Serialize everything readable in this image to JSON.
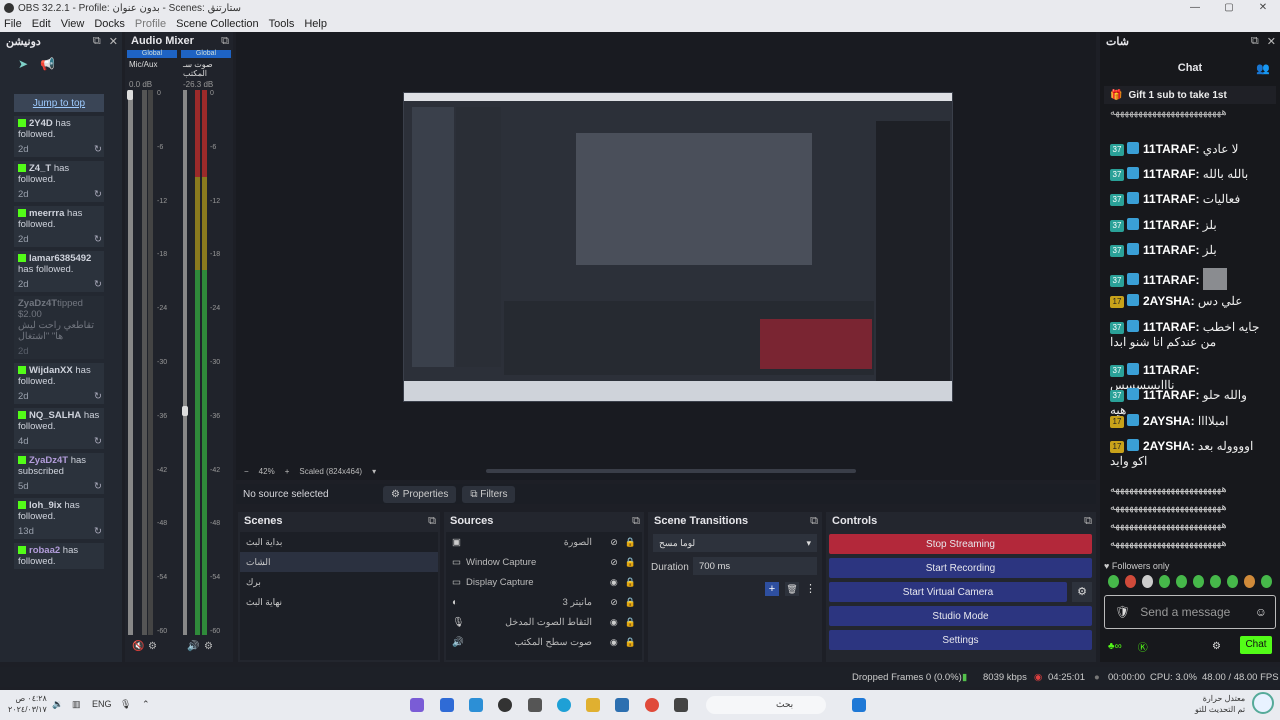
{
  "window": {
    "title": "OBS 32.2.1 - Profile: بدون عنوان - Scenes: ستارتنق",
    "min": "—",
    "max": "▢",
    "close": "✕"
  },
  "menu": [
    "File",
    "Edit",
    "View",
    "Docks",
    "Profile",
    "Scene Collection",
    "Tools",
    "Help"
  ],
  "activity": {
    "title": "دونيشن",
    "jump": "Jump to top",
    "items": [
      {
        "name": "2Y4D",
        "text": "has followed.",
        "age": "2d"
      },
      {
        "name": "Z4_T",
        "text": "has followed.",
        "age": "2d"
      },
      {
        "name": "meerrra",
        "text": "has followed.",
        "age": "2d"
      },
      {
        "name": "lamar6385492",
        "text": "has followed.",
        "age": "2d"
      },
      {
        "name": "ZyaDz4T",
        "text": "tipped $2.00",
        "extra": "تقاطعي راحت ليش ها\" \"اشتغال",
        "age": "2d"
      },
      {
        "name": "WijdanXX",
        "text": "has followed.",
        "age": "2d"
      },
      {
        "name": "NQ_SALHA",
        "text": "has followed.",
        "age": "4d"
      },
      {
        "name": "ZyaDz4T",
        "text": "has subscribed",
        "age": "5d"
      },
      {
        "name": "loh_9ix",
        "text": "has followed.",
        "age": "13d"
      },
      {
        "name": "robaa2",
        "text": "has followed.",
        "age": ""
      }
    ]
  },
  "mixer": {
    "title": "Audio Mixer",
    "chan1": {
      "tag": "Global",
      "name": "Mic/Aux",
      "db": "0.0 dB"
    },
    "chan2": {
      "tag": "Global",
      "name": "صوت سـ المكتب",
      "db": "-26.3 dB"
    },
    "ticks": [
      "0",
      "-6",
      "-12",
      "-18",
      "-24",
      "-30",
      "-36",
      "-42",
      "-48",
      "-54",
      "-60"
    ],
    "levels": {
      "chan1_fader": 0.0,
      "chan2_fader": 0.58
    }
  },
  "preview": {
    "zoom": "42%",
    "scaled": "Scaled (824x464)",
    "minus": "−",
    "plus": "+"
  },
  "sourcebar": {
    "no_source": "No source selected",
    "properties": "Properties",
    "filters": "Filters"
  },
  "scenes": {
    "title": "Scenes",
    "items": [
      "بداية البث",
      "الشات",
      "برك",
      "نهاية البث"
    ],
    "selected": 1
  },
  "sources": {
    "title": "Sources",
    "items": [
      "الصورة",
      "Window Capture",
      "Display Capture",
      "مانيتر 3",
      "التقاط الصوت المدخل",
      "صوت سطح المكتب"
    ]
  },
  "transitions": {
    "title": "Scene Transitions",
    "type": "لوما مسح",
    "duration_label": "Duration",
    "duration": "700 ms"
  },
  "controls": {
    "title": "Controls",
    "stop_stream": "Stop Streaming",
    "start_rec": "Start Recording",
    "start_vcam": "Start Virtual Camera",
    "studio": "Studio Mode",
    "settings": "Settings"
  },
  "chat": {
    "dock_title": "شات",
    "title": "Chat",
    "pinned": "Gift 1 sub to take 1st",
    "messages": [
      {
        "badge": "37",
        "user": "11TARAF:",
        "text": "لا عادي"
      },
      {
        "badge": "37",
        "user": "11TARAF:",
        "text": "بالله بالله"
      },
      {
        "badge": "37",
        "user": "11TARAF:",
        "text": "فعاليات"
      },
      {
        "badge": "37",
        "user": "11TARAF:",
        "text": "بلز"
      },
      {
        "badge": "37",
        "user": "11TARAF:",
        "text": "بلز"
      },
      {
        "badge": "37",
        "user": "11TARAF:",
        "text": ""
      },
      {
        "badge": "17",
        "user": "2AYSHA:",
        "text": "علي دس"
      },
      {
        "badge": "37",
        "user": "11TARAF:",
        "text": "جايه اخطب من عندكم انا شنو ابدا"
      },
      {
        "badge": "37",
        "user": "11TARAF:",
        "text": "نااايسسسس"
      },
      {
        "badge": "37",
        "user": "11TARAF:",
        "text": "والله حلو هيه"
      },
      {
        "badge": "17",
        "user": "2AYSHA:",
        "text": "امبلاااا"
      },
      {
        "badge": "17",
        "user": "2AYSHA:",
        "text": "اووووله بعد اكو وايد"
      }
    ],
    "spam": "ههههههههههههههههههههههههه",
    "followers_only": "Followers only",
    "placeholder": "Send a message",
    "send": "Chat"
  },
  "status": {
    "dropped": "Dropped Frames 0 (0.0%)",
    "kbps": "8039 kbps",
    "stream_time": "04:25:01",
    "rec_time": "00:00:00",
    "cpu": "CPU: 3.0%",
    "fps": "48.00 / 48.00 FPS"
  },
  "taskbar": {
    "lang": "ENG",
    "time": "٠٤:٢٨ ص",
    "date": "٢٠٢٤/٠٣/١٧",
    "weather1": "معتدل حرارة",
    "weather2": "تم التحديث للتو",
    "search": "بحث"
  }
}
